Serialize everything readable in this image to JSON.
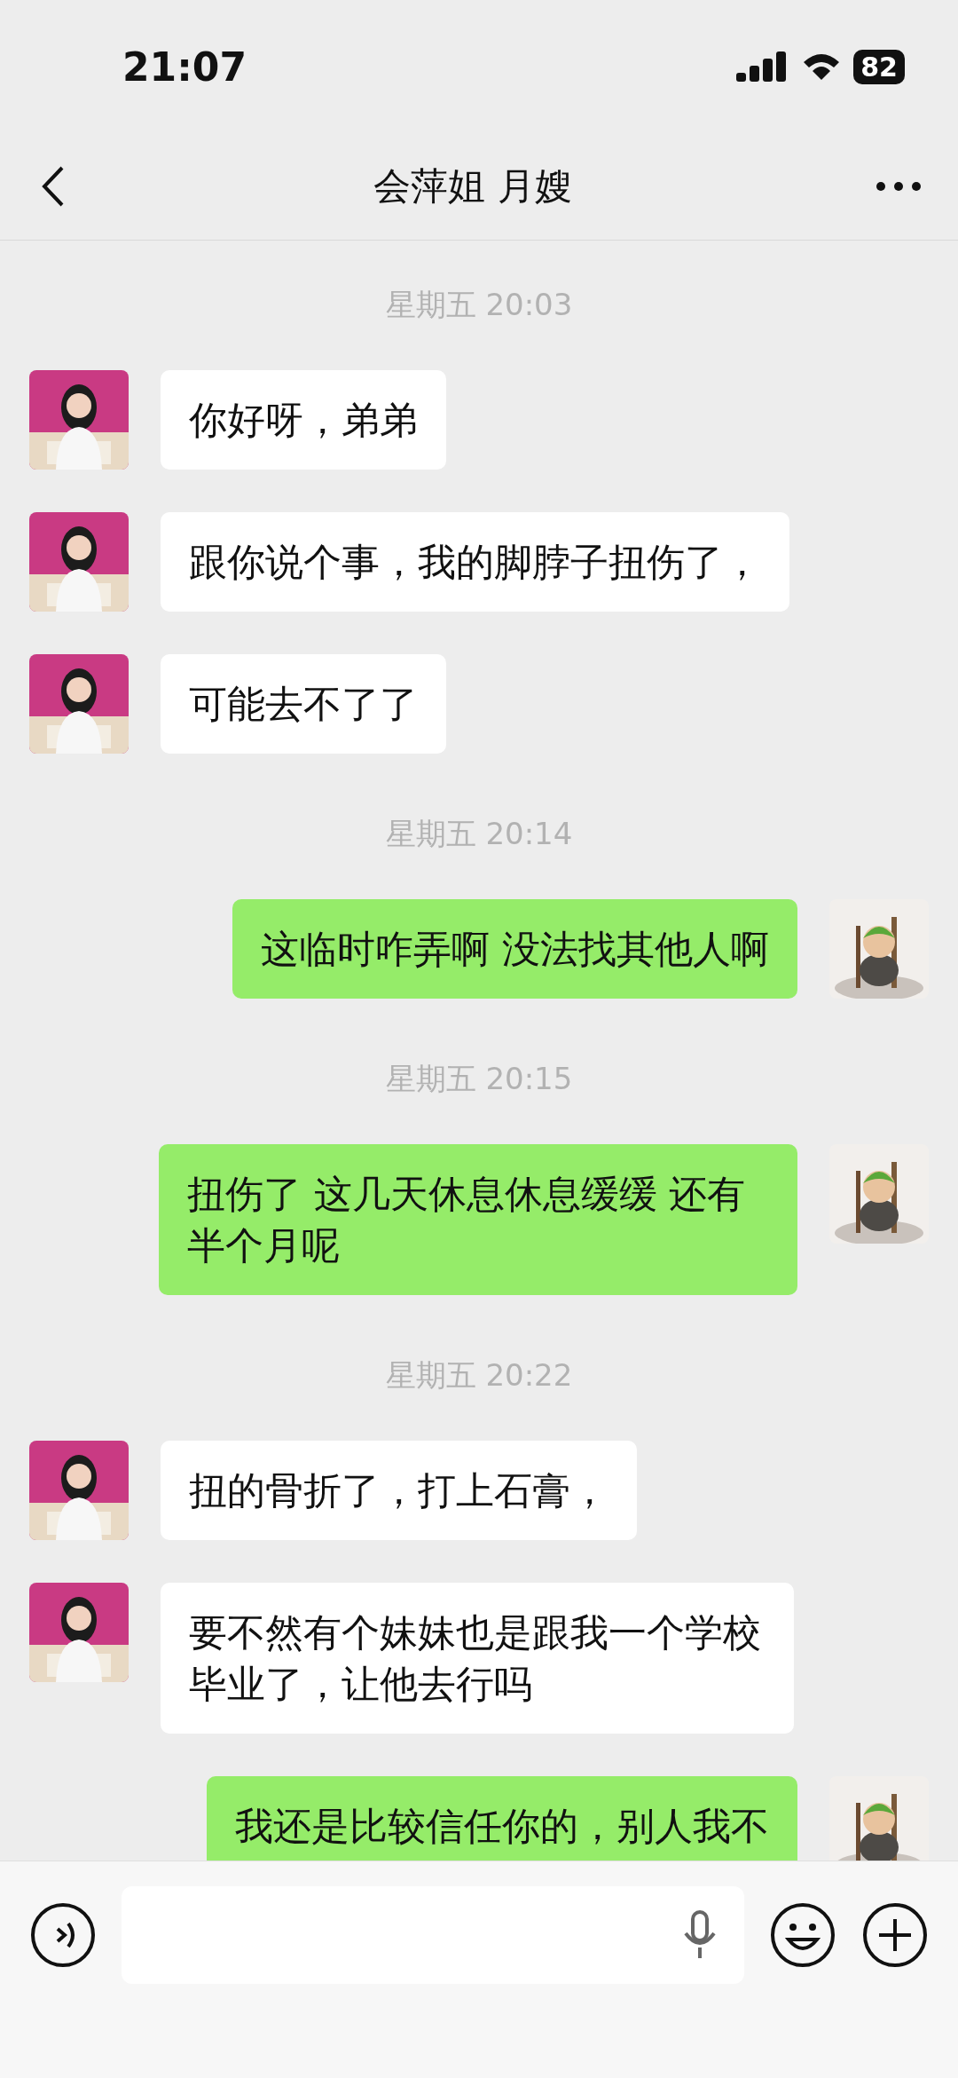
{
  "status_bar": {
    "time": "21:07",
    "battery": "82"
  },
  "header": {
    "title": "会萍姐 月嫂"
  },
  "messages": [
    {
      "kind": "time",
      "text": "星期五 20:03"
    },
    {
      "kind": "received",
      "text": "你好呀，弟弟"
    },
    {
      "kind": "received",
      "text": "跟你说个事，我的脚脖子扭伤了，"
    },
    {
      "kind": "received",
      "text": "可能去不了了"
    },
    {
      "kind": "time",
      "text": "星期五 20:14"
    },
    {
      "kind": "sent",
      "text": "这临时咋弄啊 没法找其他人啊"
    },
    {
      "kind": "time",
      "text": "星期五 20:15"
    },
    {
      "kind": "sent",
      "text": "扭伤了 这几天休息休息缓缓 还有半个月呢"
    },
    {
      "kind": "time",
      "text": "星期五 20:22"
    },
    {
      "kind": "received",
      "text": "扭的骨折了，打上石膏，"
    },
    {
      "kind": "received",
      "text": "要不然有个妹妹也是跟我一个学校毕业了，让他去行吗"
    },
    {
      "kind": "sent",
      "text": "我还是比较信任你的，别人我不"
    }
  ]
}
